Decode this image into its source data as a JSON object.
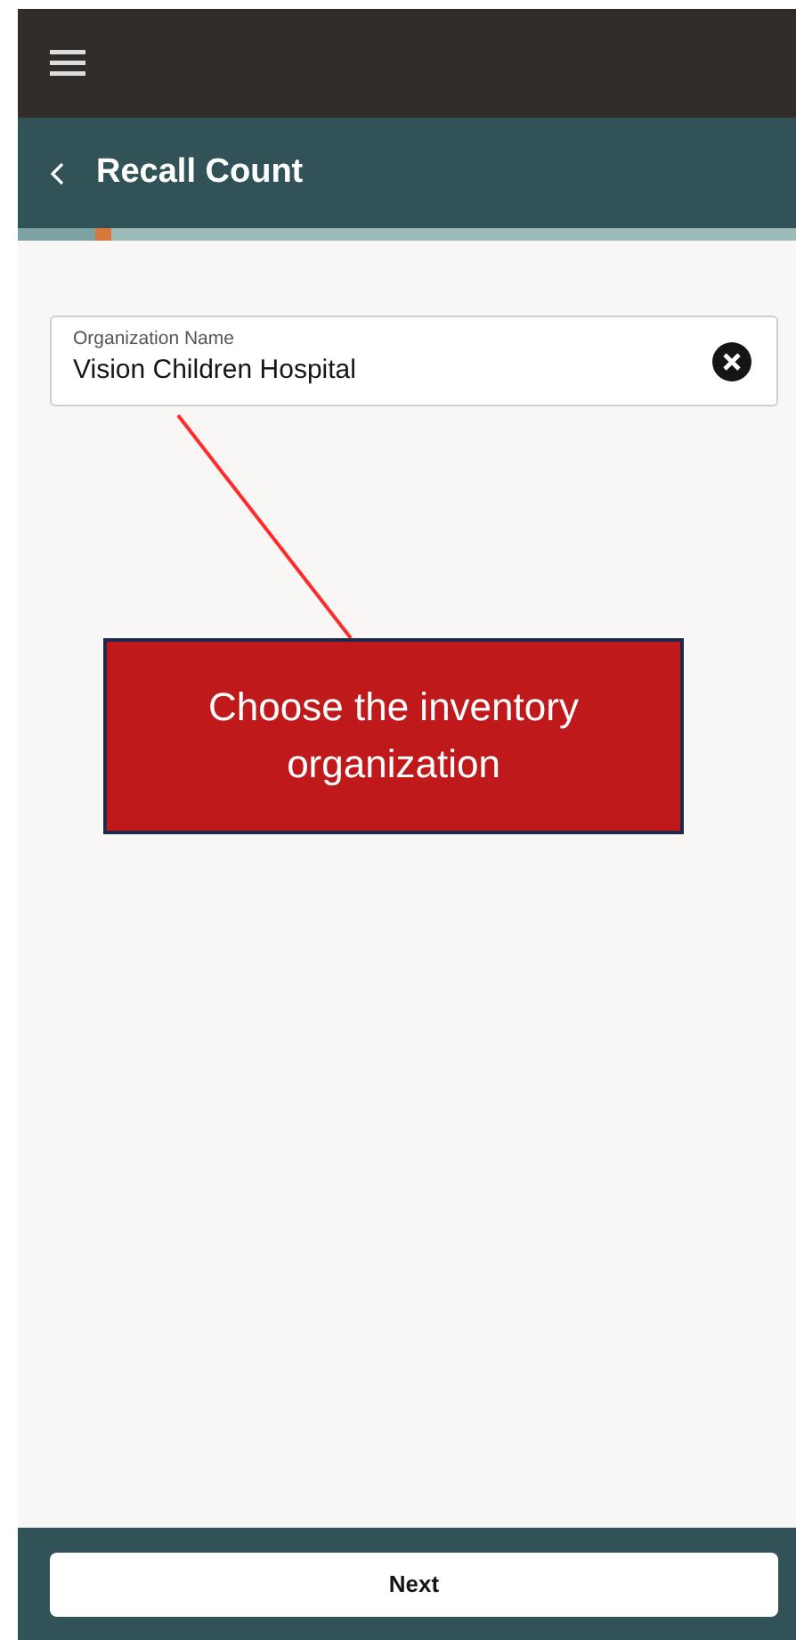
{
  "header": {
    "title": "Recall Count"
  },
  "field": {
    "label": "Organization Name",
    "value": "Vision Children Hospital"
  },
  "callout": {
    "text": "Choose the inventory organization"
  },
  "footer": {
    "buttons": [
      "Next"
    ]
  }
}
